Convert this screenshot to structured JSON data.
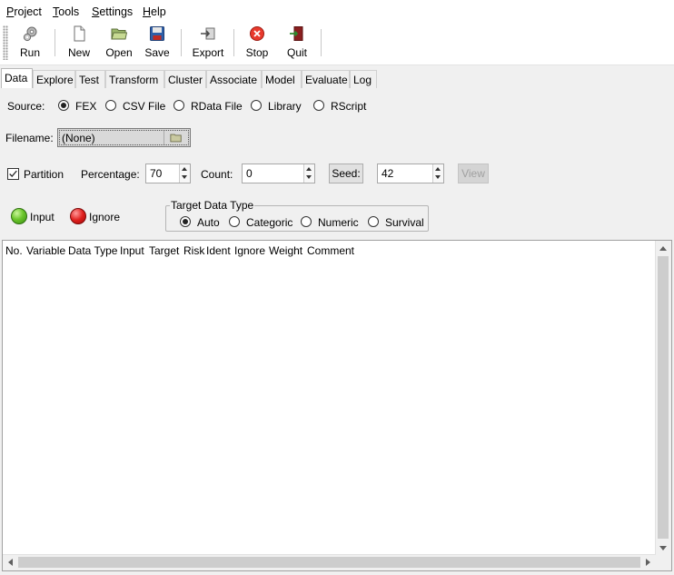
{
  "menu": [
    "Project",
    "Tools",
    "Settings",
    "Help"
  ],
  "toolbar": {
    "run": "Run",
    "new": "New",
    "open": "Open",
    "save": "Save",
    "export": "Export",
    "stop": "Stop",
    "quit": "Quit"
  },
  "tabs": [
    "Data",
    "Explore",
    "Test",
    "Transform",
    "Cluster",
    "Associate",
    "Model",
    "Evaluate",
    "Log"
  ],
  "active_tab": "Data",
  "source": {
    "label": "Source:",
    "options": [
      "FEX",
      "CSV File",
      "RData File",
      "Library",
      "RScript"
    ],
    "selected": "FEX"
  },
  "filename": {
    "label": "Filename:",
    "value": "(None)"
  },
  "partition": {
    "label": "Partition",
    "checked": true,
    "percentage_label": "Percentage:",
    "percentage": "70",
    "count_label": "Count:",
    "count": "0",
    "seed_button": "Seed:",
    "seed": "42",
    "view_button": "View"
  },
  "roles": {
    "input": "Input",
    "ignore": "Ignore"
  },
  "target_type": {
    "title": "Target Data Type",
    "options": [
      "Auto",
      "Categoric",
      "Numeric",
      "Survival"
    ],
    "selected": "Auto"
  },
  "table_headers": [
    "No.",
    "Variable",
    "Data Type",
    "Input",
    "Target",
    "Risk",
    "Ident",
    "Ignore",
    "Weight",
    "Comment"
  ],
  "colors": {
    "panel_bg": "#f0f0f0",
    "input_ball": "#6cc62c",
    "ignore_ball": "#e0201e",
    "stop_icon": "#e8392c"
  }
}
